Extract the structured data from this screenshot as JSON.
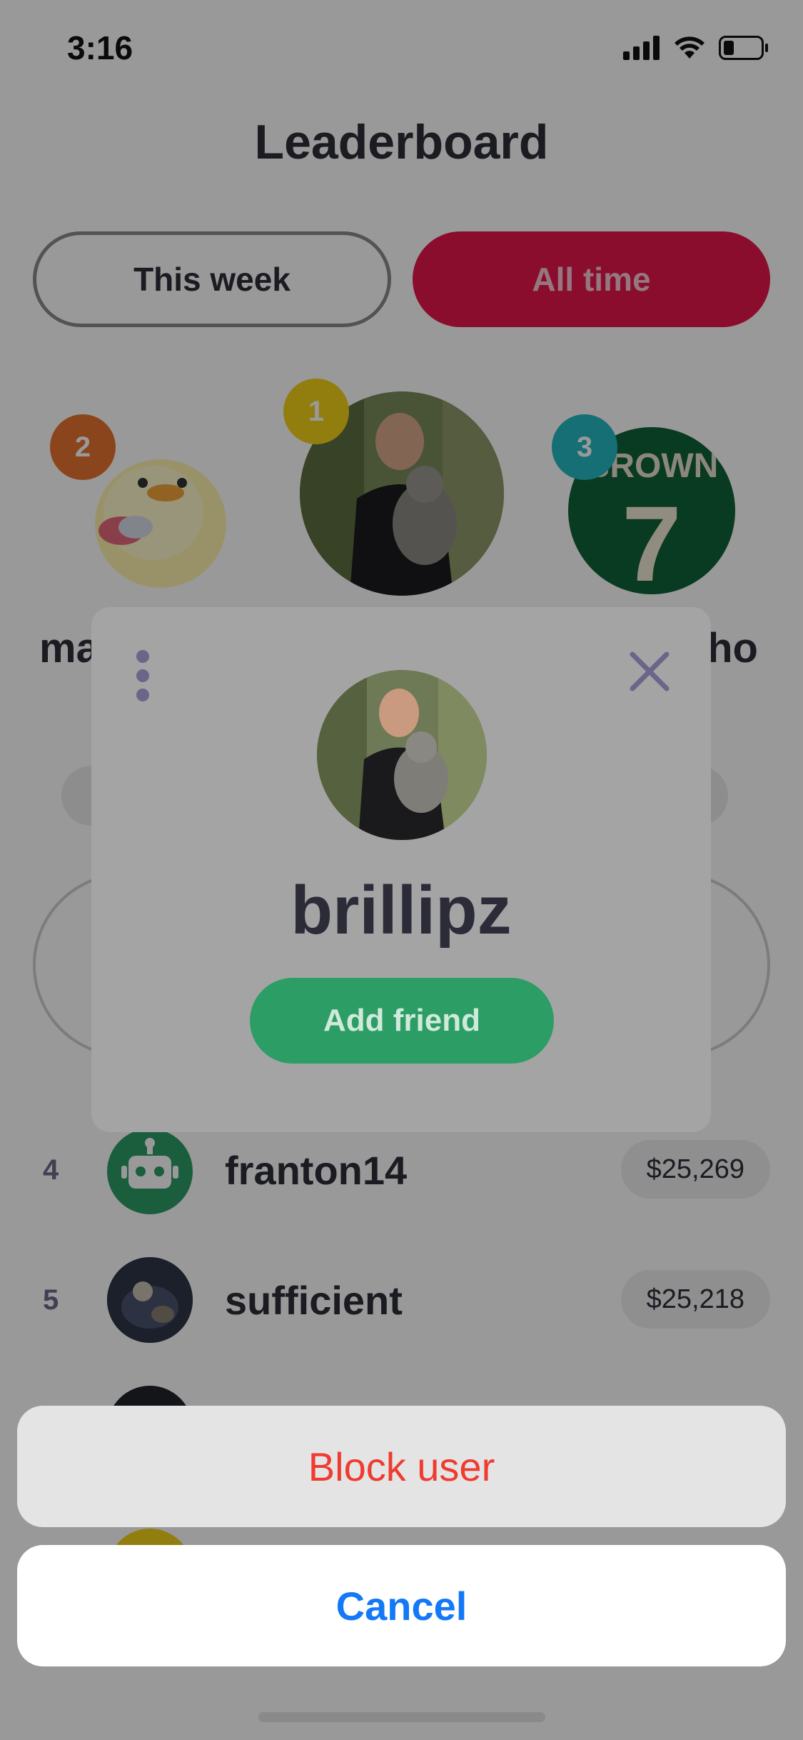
{
  "status_bar": {
    "time": "3:16",
    "battery_level": 0.25
  },
  "header": {
    "title": "Leaderboard"
  },
  "tabs": [
    {
      "label": "This week",
      "active": false
    },
    {
      "label": "All time",
      "active": true
    }
  ],
  "podium": [
    {
      "rank": "2",
      "name_visible": "ma",
      "badge_color": "#e8732f"
    },
    {
      "rank": "1",
      "name_visible": "",
      "badge_color": "#f2d21a"
    },
    {
      "rank": "3",
      "name_visible": "lho",
      "badge_color": "#23b9c2"
    }
  ],
  "leaderboard": [
    {
      "rank": "4",
      "name": "franton14",
      "amount": "$25,269",
      "avatar": "robot-icon"
    },
    {
      "rank": "5",
      "name": "sufficient",
      "amount": "$25,218",
      "avatar": "photo"
    }
  ],
  "profile_card": {
    "username": "brillipz",
    "add_friend_label": "Add friend",
    "more_icon": "more-vertical-icon",
    "close_icon": "close-icon"
  },
  "action_sheet": {
    "block_label": "Block user",
    "cancel_label": "Cancel"
  },
  "colors": {
    "accent_pink": "#e8174e",
    "add_friend_green": "#2d9d66",
    "destructive_red": "#ef3b30",
    "cancel_blue": "#1479f6"
  }
}
